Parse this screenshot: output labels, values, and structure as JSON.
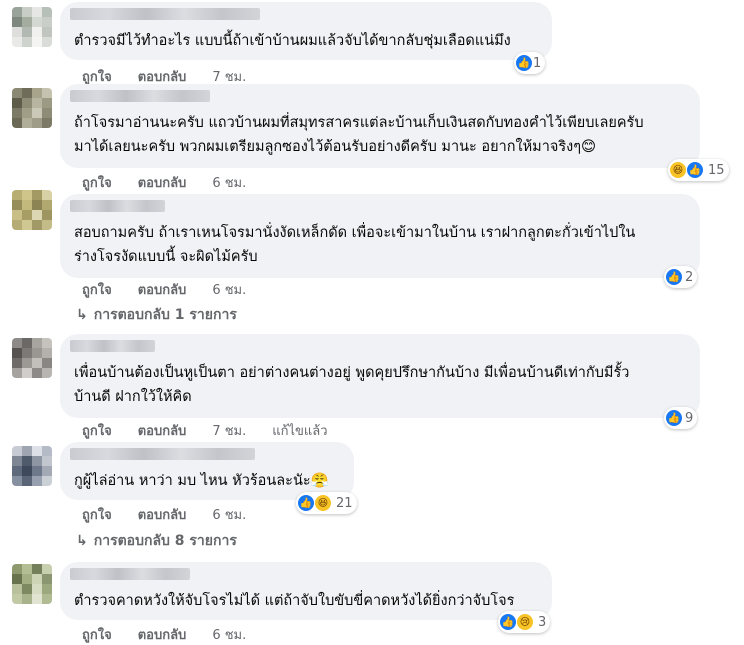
{
  "action_like": "ถูกใจ",
  "action_reply": "ตอบกลับ",
  "comments": [
    {
      "text_lines": [
        "ตำรวจมีไว้ทำอะไร แบบนี้ถ้าเข้าบ้านผมแล้วจับได้ขากลับชุ่มเลือดแน่มึง"
      ],
      "time": "7 ชม.",
      "reaction_count": "1",
      "reaction_icons": [
        "like-icon"
      ]
    },
    {
      "text_lines": [
        "ถ้าโจรมาอ่านนะครับ แถวบ้านผมที่สมุทรสาครแต่ละบ้านเก็บเงินสดกับทองคำไว้เพียบเลยครับ",
        "มาได้เลยนะครับ พวกผมเตรียมลูกซองไว้ต้อนรับอย่างดีครับ มานะ อยากให้มาจริงๆ😊"
      ],
      "time": "6 ชม.",
      "reaction_count": "15",
      "reaction_icons": [
        "haha-icon",
        "like-icon"
      ]
    },
    {
      "text_lines": [
        "สอบถามครับ ถ้าเราเหนโจรมานั่งงัดเหล็กดัด เพื่อจะเข้ามาในบ้าน เราฝากลูกตะกั่วเข้าไปใน",
        "ร่างโจรงัดแบบนี้ จะผิดไม้ครับ"
      ],
      "time": "6 ชม.",
      "reaction_count": "2",
      "reaction_icons": [
        "like-icon"
      ]
    },
    {
      "text_lines": [
        "เพื่อนบ้านต้องเป็นหูเป็นตา อย่าต่างคนต่างอยู่ พูดคุยปรึกษากันบ้าง มีเพื่อนบ้านดีเท่ากับมีรั้ว",
        "บ้านดี ฝากใว้ให้คิด"
      ],
      "time": "7 ชม.",
      "edited": "แก้ไขแล้ว",
      "reaction_count": "9",
      "reaction_icons": [
        "like-icon"
      ]
    },
    {
      "text_lines": [
        "กูผู้ไล่อ่าน หาว่า มบ ไหน หัวร้อนละนัะ😤"
      ],
      "time": "6 ชม.",
      "reaction_count": "21",
      "reaction_icons": [
        "like-icon",
        "haha-icon"
      ]
    },
    {
      "text_lines": [
        "ตำรวจคาดหวังให้จับโจรไม่ได้ แต่ถ้าจับใบขับขี่คาดหวังได้ยิ่งกว่าจับโจร"
      ],
      "time": "6 ชม.",
      "reaction_count": "3",
      "reaction_icons": [
        "like-icon",
        "sad-icon"
      ]
    }
  ],
  "replies_1": "การตอบกลับ 1 รายการ",
  "replies_2": "การตอบกลับ 8 รายการ",
  "icon_arrow": "↳",
  "colors": {
    "bubble": "#f0f2f5",
    "link": "#65676b",
    "like": "#1877f2"
  }
}
